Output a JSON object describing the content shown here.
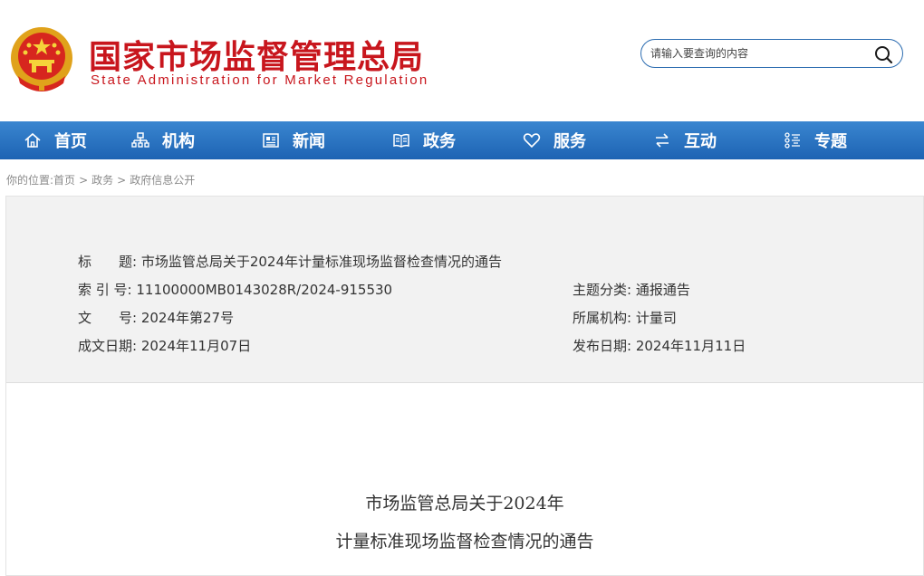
{
  "header": {
    "site_name_cn": "国家市场监督管理总局",
    "site_name_en": "State Administration for Market Regulation",
    "search": {
      "placeholder": "请输入要查询的内容",
      "value": ""
    }
  },
  "nav": {
    "items": [
      {
        "label": "首页",
        "icon": "home-icon"
      },
      {
        "label": "机构",
        "icon": "org-chart-icon"
      },
      {
        "label": "新闻",
        "icon": "newspaper-icon"
      },
      {
        "label": "政务",
        "icon": "book-icon"
      },
      {
        "label": "服务",
        "icon": "heart-icon"
      },
      {
        "label": "互动",
        "icon": "swap-arrows-icon"
      },
      {
        "label": "专题",
        "icon": "list-icon"
      }
    ]
  },
  "breadcrumb": {
    "prefix": "你的位置:",
    "items": [
      "首页",
      "政务",
      "政府信息公开"
    ],
    "separator": ">"
  },
  "meta": {
    "title_label": "标　　题:",
    "title_value": "市场监管总局关于2024年计量标准现场监督检查情况的通告",
    "index_label": "索 引 号:",
    "index_value": "11100000MB0143028R/2024-915530",
    "docno_label": "文　　号:",
    "docno_value": "2024年第27号",
    "created_label": "成文日期:",
    "created_value": "2024年11月07日",
    "category_label": "主题分类:",
    "category_value": "通报通告",
    "org_label": "所属机构:",
    "org_value": "计量司",
    "published_label": "发布日期:",
    "published_value": "2024年11月11日"
  },
  "document": {
    "title_line1": "市场监管总局关于2024年",
    "title_line2": "计量标准现场监督检查情况的通告"
  },
  "colors": {
    "brand_red": "#c8161d",
    "nav_blue": "#1d63b3",
    "meta_bg": "#f2f2f2"
  }
}
